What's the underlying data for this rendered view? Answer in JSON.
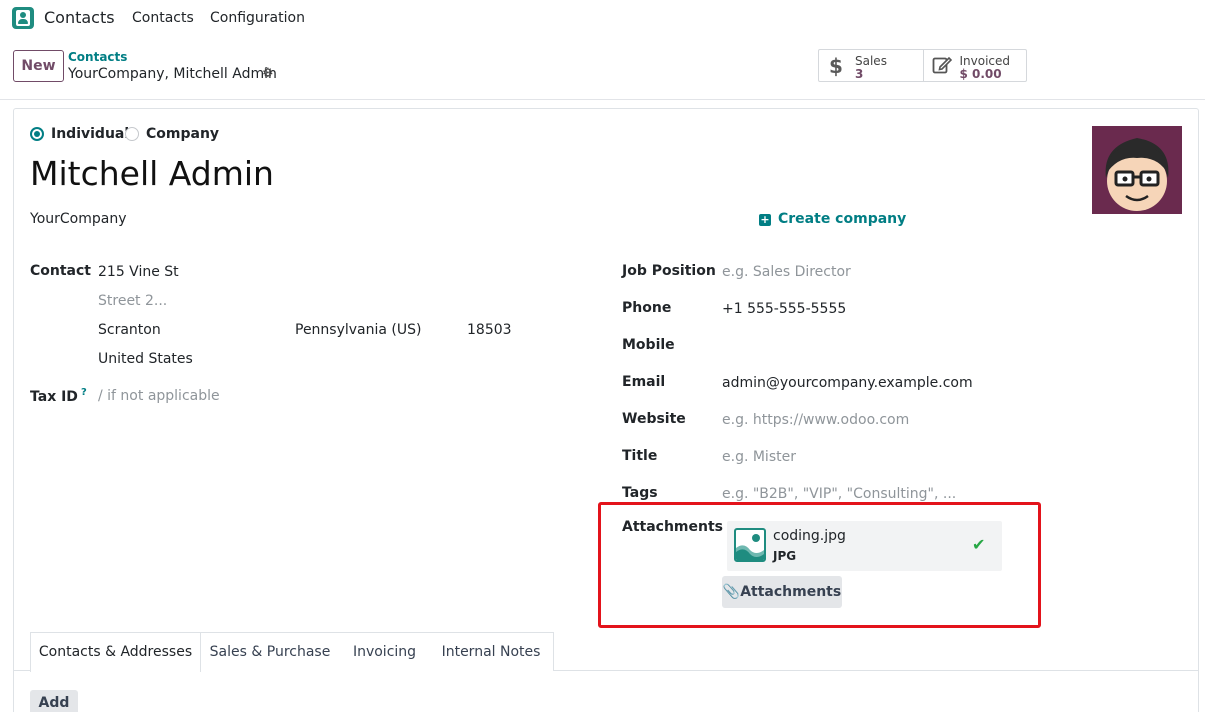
{
  "navbar": {
    "app_name": "Contacts",
    "menu": [
      "Contacts",
      "Configuration"
    ],
    "app_icon": "contacts-app-icon"
  },
  "control_panel": {
    "new_label": "New",
    "breadcrumb_parent": "Contacts",
    "breadcrumb_current": "YourCompany, Mitchell Admin",
    "settings_icon": "gear-icon",
    "smart_buttons": [
      {
        "icon": "dollar-icon",
        "label": "Sales",
        "value": "3"
      },
      {
        "icon": "invoice-edit-icon",
        "label": "Invoiced",
        "value": "$ 0.00"
      }
    ]
  },
  "form": {
    "type_options": [
      {
        "label": "Individual",
        "selected": true
      },
      {
        "label": "Company",
        "selected": false
      }
    ],
    "name": "Mitchell Admin",
    "company": "YourCompany",
    "create_company_label": "Create company",
    "left": {
      "contact_label": "Contact",
      "street": "215 Vine St",
      "street2_placeholder": "Street 2...",
      "city": "Scranton",
      "state": "Pennsylvania (US)",
      "zip": "18503",
      "country": "United States",
      "tax_label": "Tax ID",
      "tax_help": "?",
      "tax_placeholder": "/ if not applicable"
    },
    "right": {
      "job_position_label": "Job Position",
      "job_position_placeholder": "e.g. Sales Director",
      "phone_label": "Phone",
      "phone_value": "+1 555-555-5555",
      "mobile_label": "Mobile",
      "email_label": "Email",
      "email_value": "admin@yourcompany.example.com",
      "website_label": "Website",
      "website_placeholder": "e.g. https://www.odoo.com",
      "title_label": "Title",
      "title_placeholder": "e.g. Mister",
      "tags_label": "Tags",
      "tags_placeholder": "e.g. \"B2B\", \"VIP\", \"Consulting\", ..."
    },
    "attachments": {
      "label": "Attachments",
      "file_name": "coding.jpg",
      "file_ext": "JPG",
      "button_label": "Attachments",
      "highlight_color": "#e3131b"
    }
  },
  "notebook": {
    "tabs": [
      "Contacts & Addresses",
      "Sales & Purchase",
      "Invoicing",
      "Internal Notes"
    ],
    "active_tab": "Contacts & Addresses",
    "add_label": "Add"
  },
  "colors": {
    "brand": "#714b67",
    "accent": "#017e84"
  }
}
